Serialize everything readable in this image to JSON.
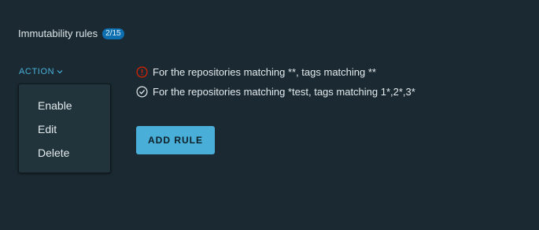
{
  "header": {
    "title": "Immutability rules",
    "count_badge": "2/15"
  },
  "action_menu": {
    "toggle_label": "ACTION",
    "items": [
      {
        "label": "Enable"
      },
      {
        "label": "Edit"
      },
      {
        "label": "Delete"
      }
    ]
  },
  "rules": [
    {
      "status": "error",
      "status_icon": "exclamation-circle-icon",
      "status_color": "#e12200",
      "text": "For the repositories matching **, tags matching **"
    },
    {
      "status": "success",
      "status_icon": "check-circle-icon",
      "status_color": "#e4ebee",
      "text": "For the repositories matching *test, tags matching 1*,2*,3*"
    }
  ],
  "add_rule_button": {
    "label": "ADD RULE"
  },
  "colors": {
    "background": "#1b2a32",
    "accent": "#49afd9",
    "badge": "#0d6fb0",
    "menu_background": "#21333b"
  }
}
